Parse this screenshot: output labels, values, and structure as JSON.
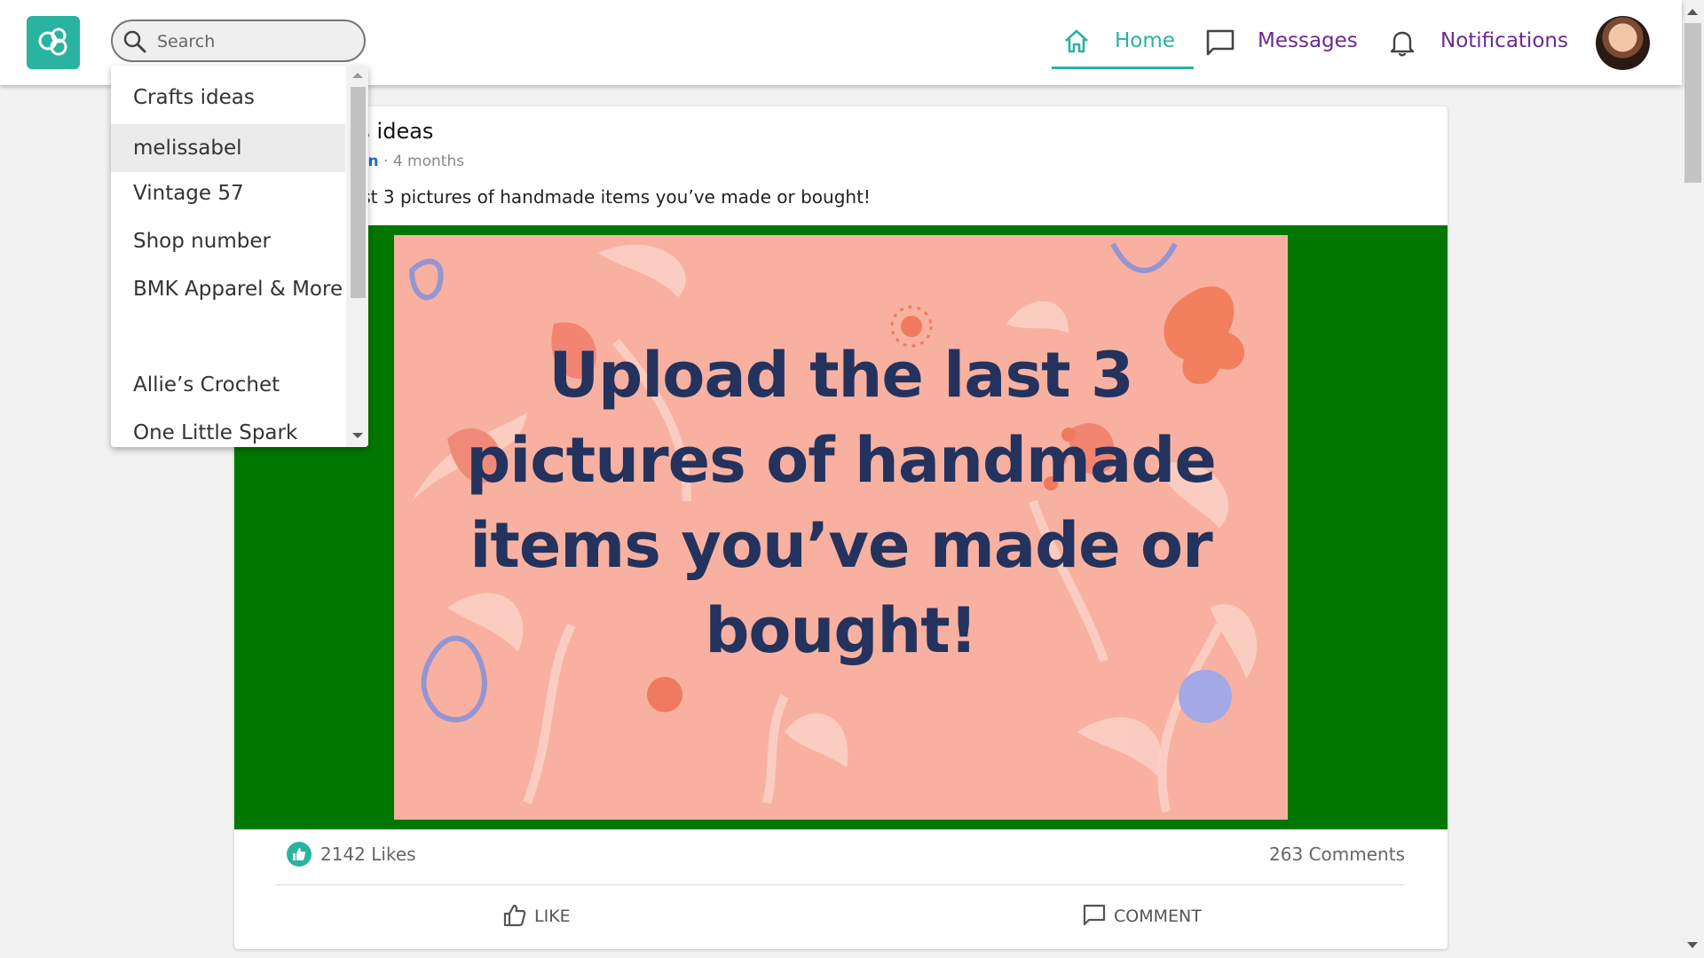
{
  "search": {
    "placeholder": "Search",
    "value": ""
  },
  "nav": {
    "home": {
      "label": "Home",
      "color": "#2ab3a0",
      "icon": "home-icon"
    },
    "messages": {
      "label": "Messages",
      "color": "#6b2b8f",
      "icon": "chat-bubble-icon"
    },
    "notifications": {
      "label": "Notifications",
      "color": "#6b2b8f",
      "icon": "bell-icon"
    }
  },
  "dropdown": {
    "items": [
      {
        "label": "Crafts ideas"
      },
      {
        "label": "melissabel",
        "highlighted": true
      },
      {
        "label": "Vintage 57"
      },
      {
        "label": "Shop number"
      },
      {
        "label": "BMK Apparel & More"
      },
      {
        "label": "Allie’s Crochet"
      },
      {
        "label": "One Little Spark"
      }
    ]
  },
  "post": {
    "title_visible": "ts ideas",
    "author_visible": "fun",
    "time": "· 4 months",
    "text_visible": "ast 3 pictures of handmade items you’ve made or bought!",
    "image_text": "Upload the last 3 pictures of handmade items you’ve made or bought!",
    "likes": "2142 Likes",
    "comments": "263 Comments",
    "like_label": "LIKE",
    "comment_label": "COMMENT"
  },
  "colors": {
    "brand": "#2ab3a0",
    "nav_text": "#6b2b8f",
    "media_frame": "#007800",
    "promo_bg": "#f8b1a0",
    "promo_text": "#24325e",
    "author_link": "#1e6fd0"
  }
}
